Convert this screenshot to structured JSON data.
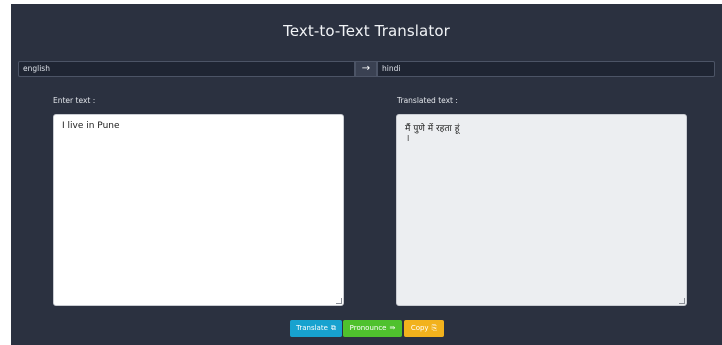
{
  "header": {
    "title": "Text-to-Text Translator"
  },
  "languages": {
    "source": "english",
    "swap_icon": "arrow-right-icon",
    "target": "hindi"
  },
  "input": {
    "label": "Enter text :",
    "value": "I live in Pune"
  },
  "output": {
    "label": "Translated text :",
    "value": "मैं पुणे में रहता हूं",
    "cursor": "I"
  },
  "buttons": {
    "translate": {
      "label": "Translate",
      "icon": "translate-icon",
      "icon_glyph": "⧉"
    },
    "pronounce": {
      "label": "Pronounce",
      "icon": "arrow-right-icon",
      "icon_glyph": "⇛"
    },
    "copy": {
      "label": "Copy",
      "icon": "copy-icon",
      "icon_glyph": "⎘"
    }
  },
  "colors": {
    "background": "#2b3140",
    "translate_button": "#17a2cf",
    "pronounce_button": "#4fc12e",
    "copy_button": "#f2b21d"
  }
}
